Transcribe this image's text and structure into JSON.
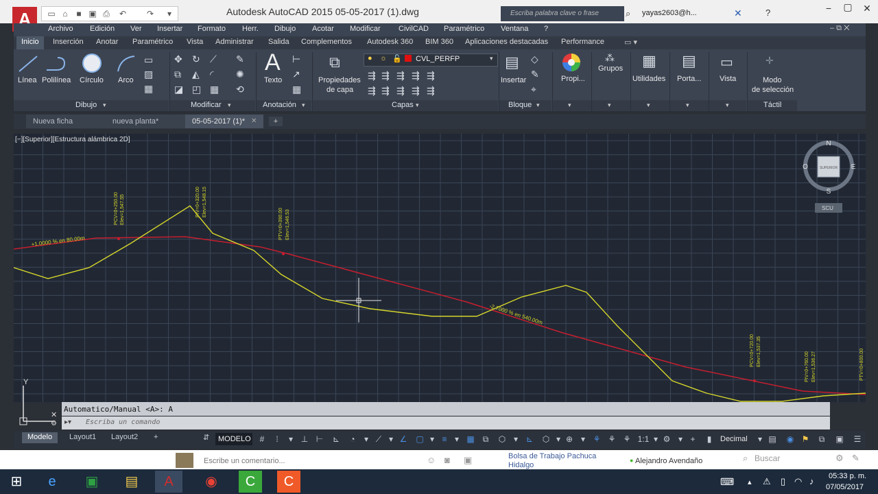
{
  "titlebar": {
    "app_title": "Autodesk AutoCAD 2015     05-05-2017 (1).dwg",
    "search_placeholder": "Escriba palabra clave o frase",
    "user": "yayas2603@h...",
    "help": "?"
  },
  "menubar": [
    "Archivo",
    "Edición",
    "Ver",
    "Insertar",
    "Formato",
    "Herr.",
    "Dibujo",
    "Acotar",
    "Modificar",
    "CivilCAD",
    "Paramétrico",
    "Ventana",
    "?"
  ],
  "ribbon_tabs": [
    "Inicio",
    "Inserción",
    "Anotar",
    "Paramétrico",
    "Vista",
    "Administrar",
    "Salida",
    "Complementos",
    "Autodesk 360",
    "BIM 360",
    "Aplicaciones destacadas",
    "Performance"
  ],
  "ribbon": {
    "draw": {
      "linea": "Línea",
      "polilinea": "Polilínea",
      "circulo": "Círculo",
      "arco": "Arco",
      "panel": "Dibujo"
    },
    "modify": {
      "panel": "Modificar"
    },
    "annotation": {
      "texto": "Texto",
      "panel": "Anotación"
    },
    "layers": {
      "props_line1": "Propiedades",
      "props_line2": "de capa",
      "current_layer": "CVL_PERFP",
      "panel": "Capas"
    },
    "block": {
      "insertar": "Insertar",
      "panel": "Bloque"
    },
    "others": {
      "propi": "Propi...",
      "grupos": "Grupos",
      "utilidades": "Utilidades",
      "porta": "Porta...",
      "vista": "Vista",
      "modo1": "Modo",
      "modo2": "de selección",
      "tactil": "Táctil"
    }
  },
  "doc_tabs": [
    "Nueva ficha",
    "nueva planta*",
    "05-05-2017 (1)*"
  ],
  "viewport_label": "[−][Superior][Estructura alámbrica 2D]",
  "viewcube": {
    "n": "N",
    "s": "S",
    "e": "E",
    "o": "O",
    "face": "SUPERIOR",
    "ucs": "SCU"
  },
  "drawing_labels": {
    "slope1": "+1.0000 % en 80.00m",
    "slope2": "-2.7000 % en 540.00m",
    "pv1": "PCV=0+250.00",
    "pv1_elev": "Elev=1,547.55",
    "pv2": "PIV=0+320.00",
    "pv2_elev": "Elev=1,548.15",
    "pv3": "PTV=0+390.00",
    "pv3_elev": "Elev=1,546.53",
    "pv4": "PCV=0+720.00",
    "pv4_elev": "Elev=1,537.35",
    "pv5": "PIV=0+760.00",
    "pv5_elev": "Elev=1,536.27",
    "pv6": "PTV=0+800.00",
    "ucs_y": "Y"
  },
  "command": {
    "history": "Automatico/Manual <A>: A",
    "placeholder": "Escriba un comando"
  },
  "status": {
    "layouts": [
      "Modelo",
      "Layout1",
      "Layout2"
    ],
    "modelo": "MODELO",
    "scale": "1:1",
    "units": "Decimal"
  },
  "fb": {
    "comment": "Escribe un comentario...",
    "bolsa1": "Bolsa de Trabajo Pachuca",
    "bolsa2": "Hidalgo",
    "name": "Alejandro Avendaño",
    "search": "Buscar"
  },
  "clock": {
    "time": "05:33 p. m.",
    "date": "07/05/2017"
  },
  "colors": {
    "accent": "#c8282d",
    "grid": "#3a4556",
    "profile": "#d6d62a",
    "grade": "#c81e2e"
  }
}
